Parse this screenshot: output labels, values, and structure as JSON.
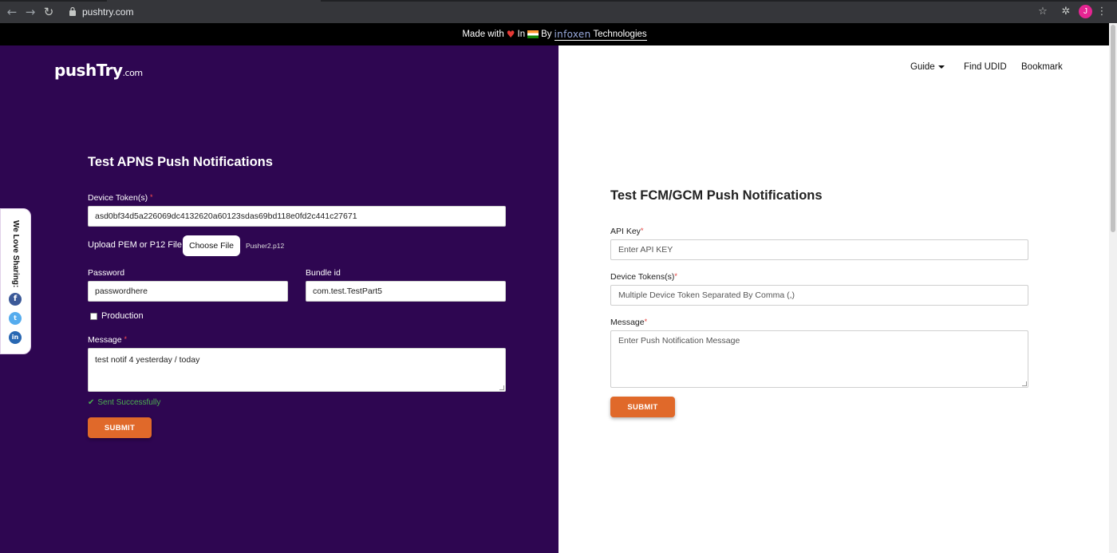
{
  "browser": {
    "url": "pushtry.com",
    "avatar_letter": "J"
  },
  "banner": {
    "made_with": "Made with",
    "in": "In",
    "by": "By",
    "company_logo": "infoxen",
    "company_name": "Technologies"
  },
  "header": {
    "logo_text": "pushTry",
    "logo_suffix": ".com",
    "nav": [
      {
        "label": "Guide"
      },
      {
        "label": "Find UDID"
      },
      {
        "label": "Bookmark"
      }
    ]
  },
  "apns": {
    "title": "Test APNS Push Notifications",
    "device_token_label": "Device Token(s)",
    "device_token_value": "asd0bf34d5a226069dc4132620a60123sdas69bd118e0fd2c441c27671",
    "upload_label": "Upload PEM or P12 File:",
    "choose_file_label": "Choose File",
    "file_name": "Pusher2.p12",
    "password_label": "Password",
    "password_value": "passwordhere",
    "bundle_label": "Bundle id",
    "bundle_value": "com.test.TestPart5",
    "production_label": "Production",
    "production_checked": false,
    "message_label": "Message",
    "message_value": "test notif 4 yesterday / today",
    "status_text": "Sent Successfully",
    "submit_label": "SUBMIT"
  },
  "fcm": {
    "title": "Test FCM/GCM Push Notifications",
    "api_key_label": "API Key",
    "api_key_placeholder": "Enter API KEY",
    "device_tokens_label": "Device Tokens(s)",
    "device_tokens_placeholder": "Multiple Device Token Separated By Comma (,)",
    "message_label": "Message",
    "message_placeholder": "Enter Push Notification Message",
    "submit_label": "SUBMIT"
  },
  "share": {
    "label": "We Love Sharing:",
    "icons": [
      "facebook-icon",
      "twitter-icon",
      "linkedin-icon"
    ]
  },
  "colors": {
    "left_panel_bg": "#2e0651",
    "accent": "#e0692a",
    "success": "#4caf50"
  }
}
